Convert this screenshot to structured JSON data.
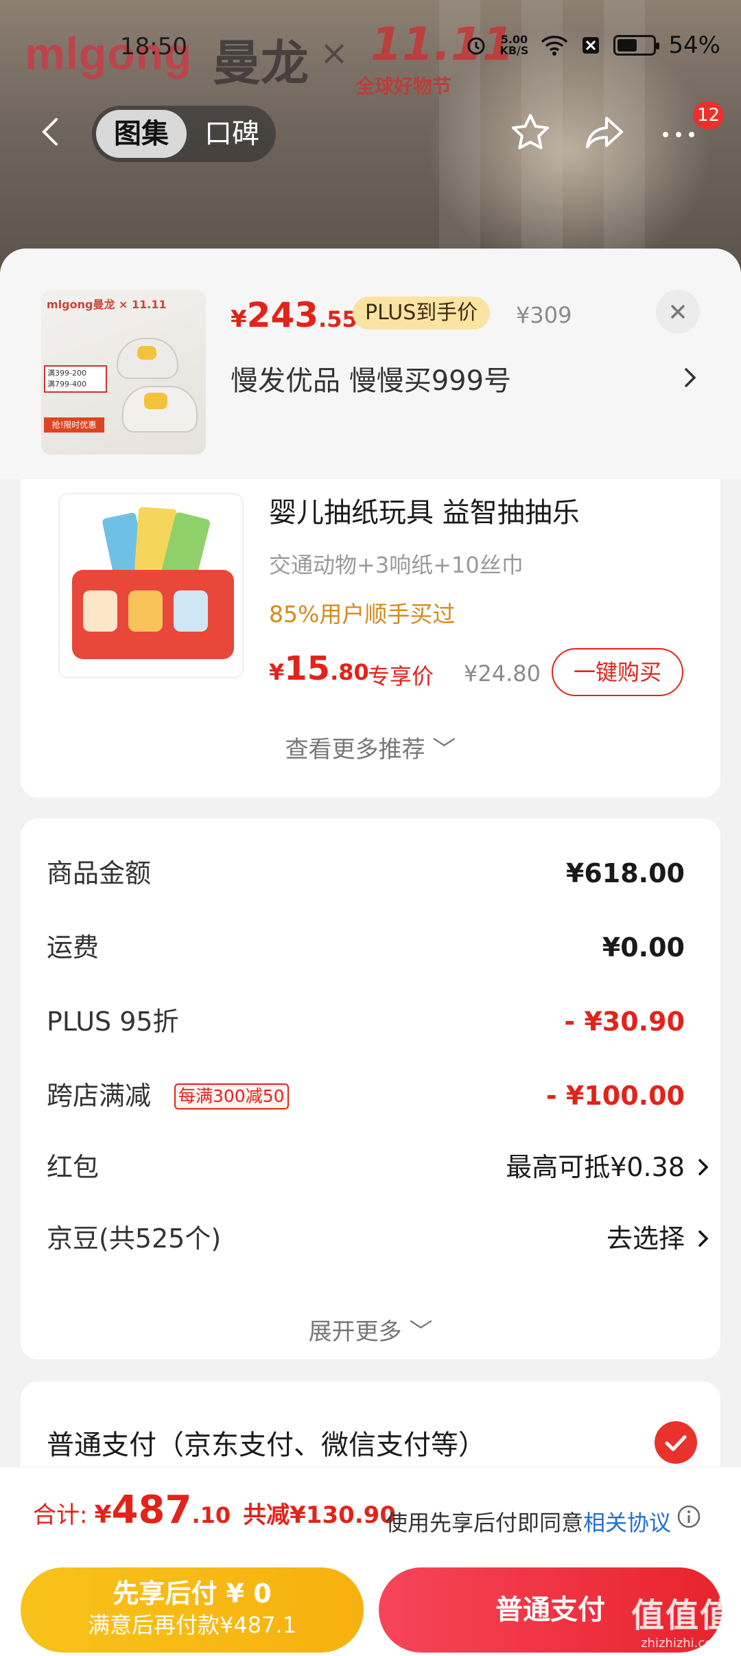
{
  "status_bar": {
    "time": "18:50",
    "net_speed": "5.00",
    "net_unit": "KB/S",
    "battery": "54%"
  },
  "brand": {
    "logo": "mlgong",
    "name": "曼龙",
    "times": "×",
    "event": "11.11",
    "event_sub": "全球好物节"
  },
  "nav": {
    "tab_gallery": "图集",
    "tab_reviews": "口碑",
    "badge": "12"
  },
  "product": {
    "price_currency": "¥",
    "price_int": "243",
    "price_dec": ".55",
    "plus_label": "PLUS到手价",
    "original_price": "¥309",
    "store": "慢发优品  慢慢买999号"
  },
  "recommend": {
    "title": "婴儿抽纸玩具 益智抽抽乐",
    "subtitle": "交通动物+3响纸+10丝巾",
    "hot": "85%用户顺手买过",
    "price_currency": "¥",
    "price_int": "15",
    "price_dec": ".80",
    "price_tag": "专享价",
    "original_price": "¥24.80",
    "buy_label": "一键购买",
    "more_label": "查看更多推荐"
  },
  "fees": {
    "rows": [
      {
        "label": "商品金额",
        "value": "¥618.00"
      },
      {
        "label": "运费",
        "value": "¥0.00"
      },
      {
        "label": "PLUS 95折",
        "value": "- ¥30.90"
      },
      {
        "label": "跨店满减",
        "tag": "每满300减50",
        "value": "- ¥100.00"
      },
      {
        "label": "红包",
        "value": "最高可抵¥0.38"
      },
      {
        "label": "京豆(共525个)",
        "value": "去选择"
      }
    ],
    "expand_label": "展开更多"
  },
  "payment": {
    "method": "普通支付（京东支付、微信支付等）"
  },
  "bottom": {
    "total_label": "合计:",
    "total_currency": "¥",
    "total_int": "487",
    "total_dec": ".10",
    "saved": "共减¥130.90",
    "agree_text": "使用先享后付即同意",
    "agree_link": "相关协议",
    "later_title": "先享后付 ¥ 0",
    "later_sub": "满意后再付款¥487.1",
    "normal_pay": "普通支付"
  },
  "watermark": {
    "main": "值值值",
    "sub": "zhizhizhi.com"
  },
  "colors": {
    "accent_red": "#e2231a",
    "plus_gold": "#fbe3a4",
    "later_yellow": "#f8c21a",
    "link_blue": "#1f6fd6"
  }
}
